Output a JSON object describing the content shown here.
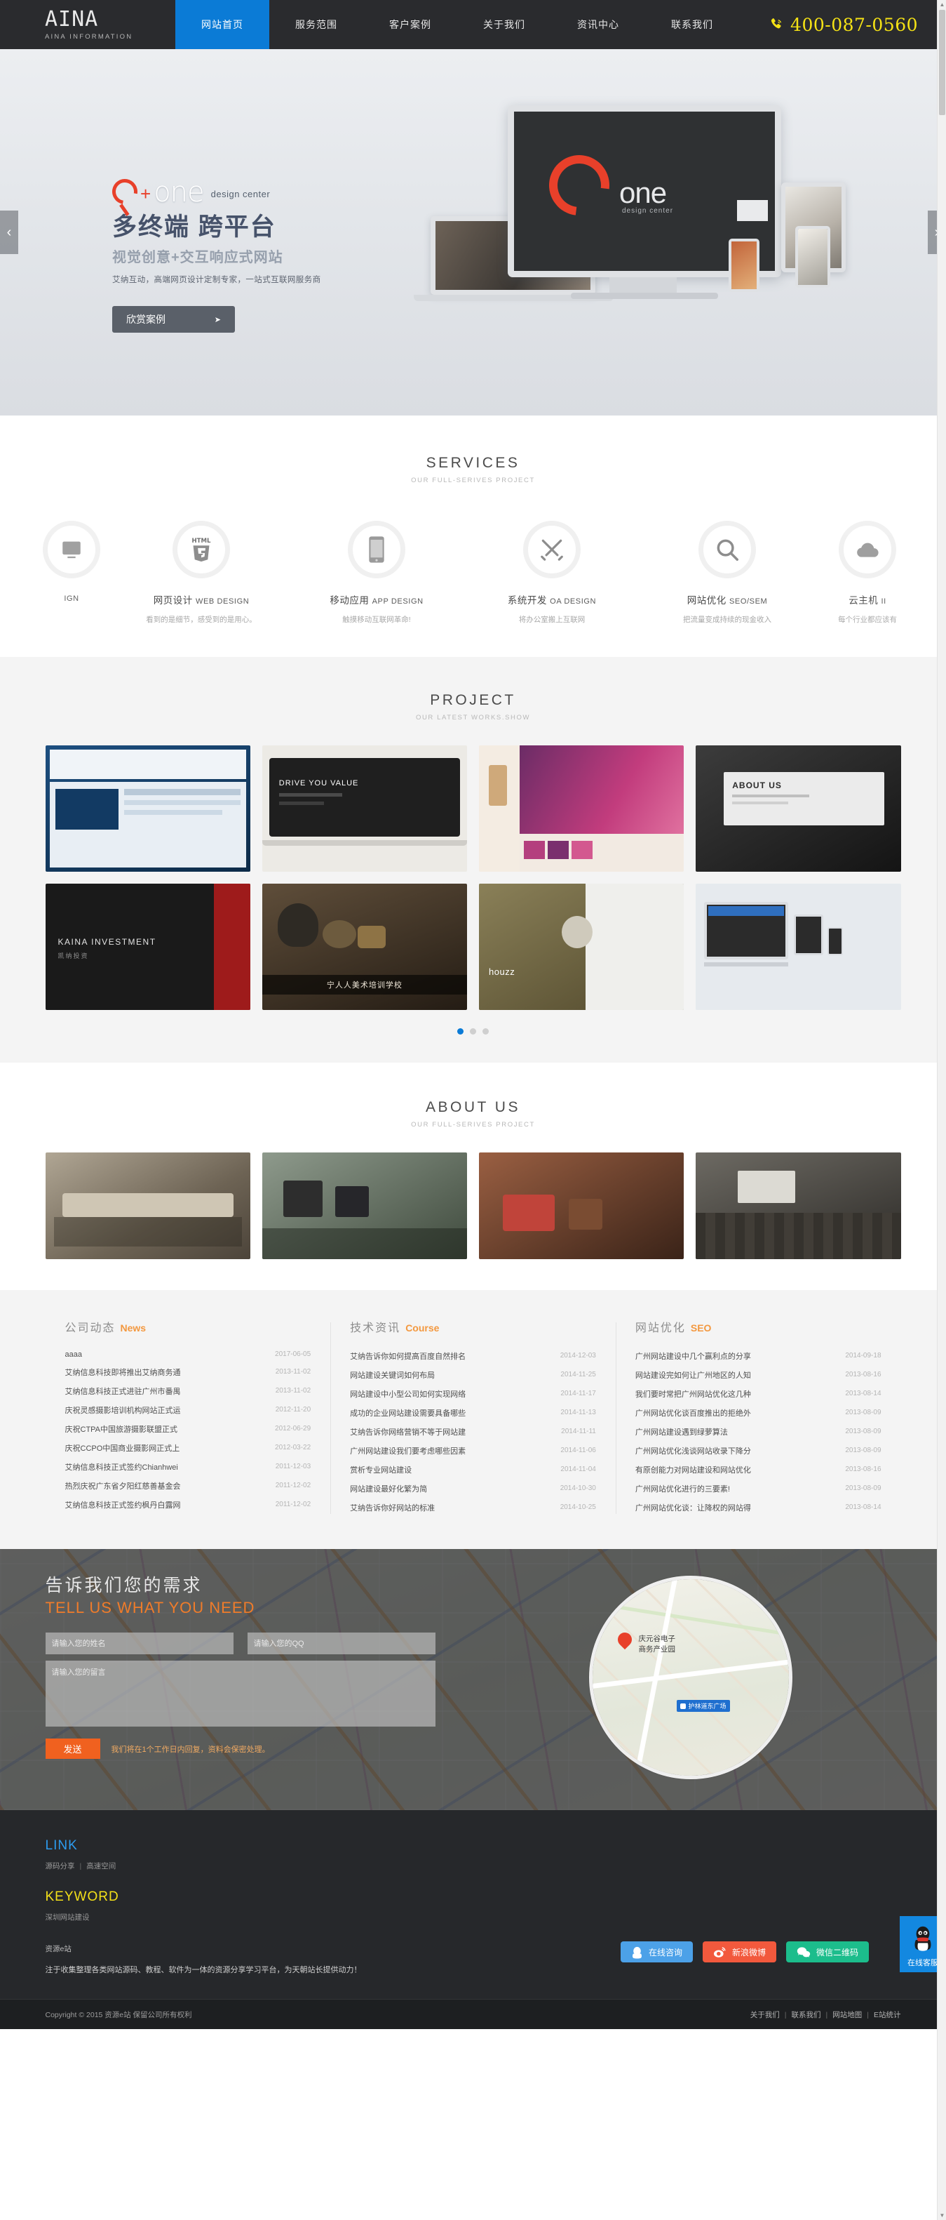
{
  "header": {
    "logo": "AINA",
    "logo_sub": "AINA INFORMATION",
    "nav": [
      {
        "label": "网站首页",
        "active": true
      },
      {
        "label": "服务范围",
        "active": false
      },
      {
        "label": "客户案例",
        "active": false
      },
      {
        "label": "关于我们",
        "active": false
      },
      {
        "label": "资讯中心",
        "active": false
      },
      {
        "label": "联系我们",
        "active": false
      }
    ],
    "phone": "400-087-0560",
    "phone_icon": "phone-icon"
  },
  "hero": {
    "brand_plus": "+",
    "brand_one": "one",
    "brand_tag": "design center",
    "title": "多终端 跨平台",
    "subtitle": "视觉创意+交互响应式网站",
    "desc": "艾纳互动，高端网页设计定制专家，一站式互联网服务商",
    "button": "欣赏案例",
    "button_arrow": "➤",
    "prev_arrow": "‹",
    "next_arrow": "›",
    "screen_text": "one",
    "screen_sub": "design center"
  },
  "services": {
    "title": "SERVICES",
    "subtitle": "OUR FULL-SERIVES PROJECT",
    "items": [
      {
        "icon": "ui-design-icon",
        "name": "",
        "en": "IGN",
        "desc": ""
      },
      {
        "icon": "html5-icon",
        "name": "网页设计",
        "en": "WEB DESIGN",
        "desc": "看到的是细节，感受到的是用心。"
      },
      {
        "icon": "mobile-icon",
        "name": "移动应用",
        "en": "APP DESIGN",
        "desc": "触摸移动互联网革命!"
      },
      {
        "icon": "tools-icon",
        "name": "系统开发",
        "en": "OA DESIGN",
        "desc": "将办公室搬上互联网"
      },
      {
        "icon": "magnifier-icon",
        "name": "网站优化",
        "en": "SEO/SEM",
        "desc": "把流量变成持续的现金收入"
      },
      {
        "icon": "cloud-icon",
        "name": "云主机",
        "en": "II",
        "desc": "每个行业都应该有"
      }
    ]
  },
  "project": {
    "title": "PROJECT",
    "subtitle": "OUR LATEST WORKS.SHOW",
    "tiles": [
      {
        "label": "",
        "bg": "#16436e",
        "kind": "site-blue"
      },
      {
        "label": "DRIVE YOU VALUE",
        "bg": "#eceae5",
        "kind": "laptop-white"
      },
      {
        "label": "",
        "bg": "#f3e9df",
        "kind": "purple-poster"
      },
      {
        "label": "ABOUT US",
        "bg": "#2b2b2b",
        "kind": "dark-about"
      },
      {
        "label": "KAINA INVESTMENT",
        "bg": "#1f1f1f",
        "kind": "kaina-red"
      },
      {
        "label": "宁人人美术培训学校",
        "bg": "#3a2e22",
        "kind": "art-school"
      },
      {
        "label": "houzz",
        "bg": "#8e8a6d",
        "kind": "houzz"
      },
      {
        "label": "",
        "bg": "#dfe3e8",
        "kind": "responsive-devices"
      }
    ],
    "dots": [
      true,
      false,
      false
    ]
  },
  "about": {
    "title": "ABOUT US",
    "subtitle": "OUR FULL-SERIVES PROJECT",
    "tiles": [
      {
        "bg": "#8c8274",
        "kind": "meeting-room"
      },
      {
        "bg": "#5f6a5e",
        "kind": "office-desk"
      },
      {
        "bg": "#7b4f3a",
        "kind": "lounge"
      },
      {
        "bg": "#4d4a45",
        "kind": "seminar"
      }
    ]
  },
  "news": {
    "columns": [
      {
        "title": "公司动态",
        "en": "News",
        "items": [
          {
            "title": "aaaa",
            "date": "2017-06-05"
          },
          {
            "title": "艾纳信息科技即将推出艾纳商务通",
            "date": "2013-11-02"
          },
          {
            "title": "艾纳信息科技正式进驻广州市番禺",
            "date": "2013-11-02"
          },
          {
            "title": "庆祝灵感摄影培训机构网站正式运",
            "date": "2012-11-20"
          },
          {
            "title": "庆祝CTPA中国旅游摄影联盟正式",
            "date": "2012-06-29"
          },
          {
            "title": "庆祝CCPO中国商业摄影网正式上",
            "date": "2012-03-22"
          },
          {
            "title": "艾纳信息科技正式签约Chianhwei",
            "date": "2011-12-03"
          },
          {
            "title": "热烈庆祝广东省夕阳红慈善基金会",
            "date": "2011-12-02"
          },
          {
            "title": "艾纳信息科技正式签约枫丹白露网",
            "date": "2011-12-02"
          }
        ]
      },
      {
        "title": "技术资讯",
        "en": "Course",
        "items": [
          {
            "title": "艾纳告诉你如何提高百度自然排名",
            "date": "2014-12-03"
          },
          {
            "title": "网站建设关键词如何布局",
            "date": "2014-11-25"
          },
          {
            "title": "网站建设中小型公司如何实现网络",
            "date": "2014-11-17"
          },
          {
            "title": "成功的企业网站建设需要具备哪些",
            "date": "2014-11-13"
          },
          {
            "title": "艾纳告诉你网络营销不等于网站建",
            "date": "2014-11-11"
          },
          {
            "title": "广州网站建设我们要考虑哪些因素",
            "date": "2014-11-06"
          },
          {
            "title": "赏析专业网站建设",
            "date": "2014-11-04"
          },
          {
            "title": "网站建设最好化繁为简",
            "date": "2014-10-30"
          },
          {
            "title": "艾纳告诉你好网站的标准",
            "date": "2014-10-25"
          }
        ]
      },
      {
        "title": "网站优化",
        "en": "SEO",
        "items": [
          {
            "title": "广州网站建设中几个赢利点的分享",
            "date": "2014-09-18"
          },
          {
            "title": "网站建设完如何让广州地区的人知",
            "date": "2013-08-16"
          },
          {
            "title": "我们要时常把广州网站优化这几种",
            "date": "2013-08-14"
          },
          {
            "title": "广州网站优化谈百度推出的拒绝外",
            "date": "2013-08-09"
          },
          {
            "title": "广州网站建设遇到绿萝算法",
            "date": "2013-08-09"
          },
          {
            "title": "广州网站优化浅谈网站收录下降分",
            "date": "2013-08-09"
          },
          {
            "title": "有原创能力对网站建设和网站优化",
            "date": "2013-08-16"
          },
          {
            "title": "广州网站优化进行的三要素!",
            "date": "2013-08-09"
          },
          {
            "title": "广州网站优化谈：让降权的网站得",
            "date": "2013-08-14"
          }
        ]
      }
    ]
  },
  "contact": {
    "title": "告诉我们您的需求",
    "title_en": "TELL US WHAT YOU NEED",
    "name_placeholder": "请输入您的姓名",
    "qq_placeholder": "请输入您的QQ",
    "message_placeholder": "请输入您的留言",
    "send_label": "发送",
    "note": "我们将在1个工作日内回复，资料会保密处理。",
    "map_label": "庆元谷电子\n商务产业园",
    "map_metro": "护林道东广场"
  },
  "footer": {
    "link_title": "LINK",
    "link_items": [
      "源码分享",
      "高速空间"
    ],
    "keyword_title": "KEYWORD",
    "keyword_items": [
      "深圳网站建设"
    ],
    "site_name": "资源e站",
    "site_desc": "注于收集整理各类网站源码、教程、软件为一体的资源分享学习平台，为天朝站长提供动力！",
    "social": [
      {
        "label": "在线咨询",
        "icon": "qq-penguin-icon",
        "color": "#4ca1e8"
      },
      {
        "label": "新浪微博",
        "icon": "weibo-icon",
        "color": "#f2593d"
      },
      {
        "label": "微信二维码",
        "icon": "wechat-icon",
        "color": "#1cbd8c"
      }
    ],
    "kefu_label": "在线客服",
    "kefu_icon": "qq-penguin-icon",
    "copyright": "Copyright © 2015 资源e站 保留公司所有权利",
    "bottom_links": [
      "关于我们",
      "联系我们",
      "网站地图",
      "E站统计"
    ]
  }
}
